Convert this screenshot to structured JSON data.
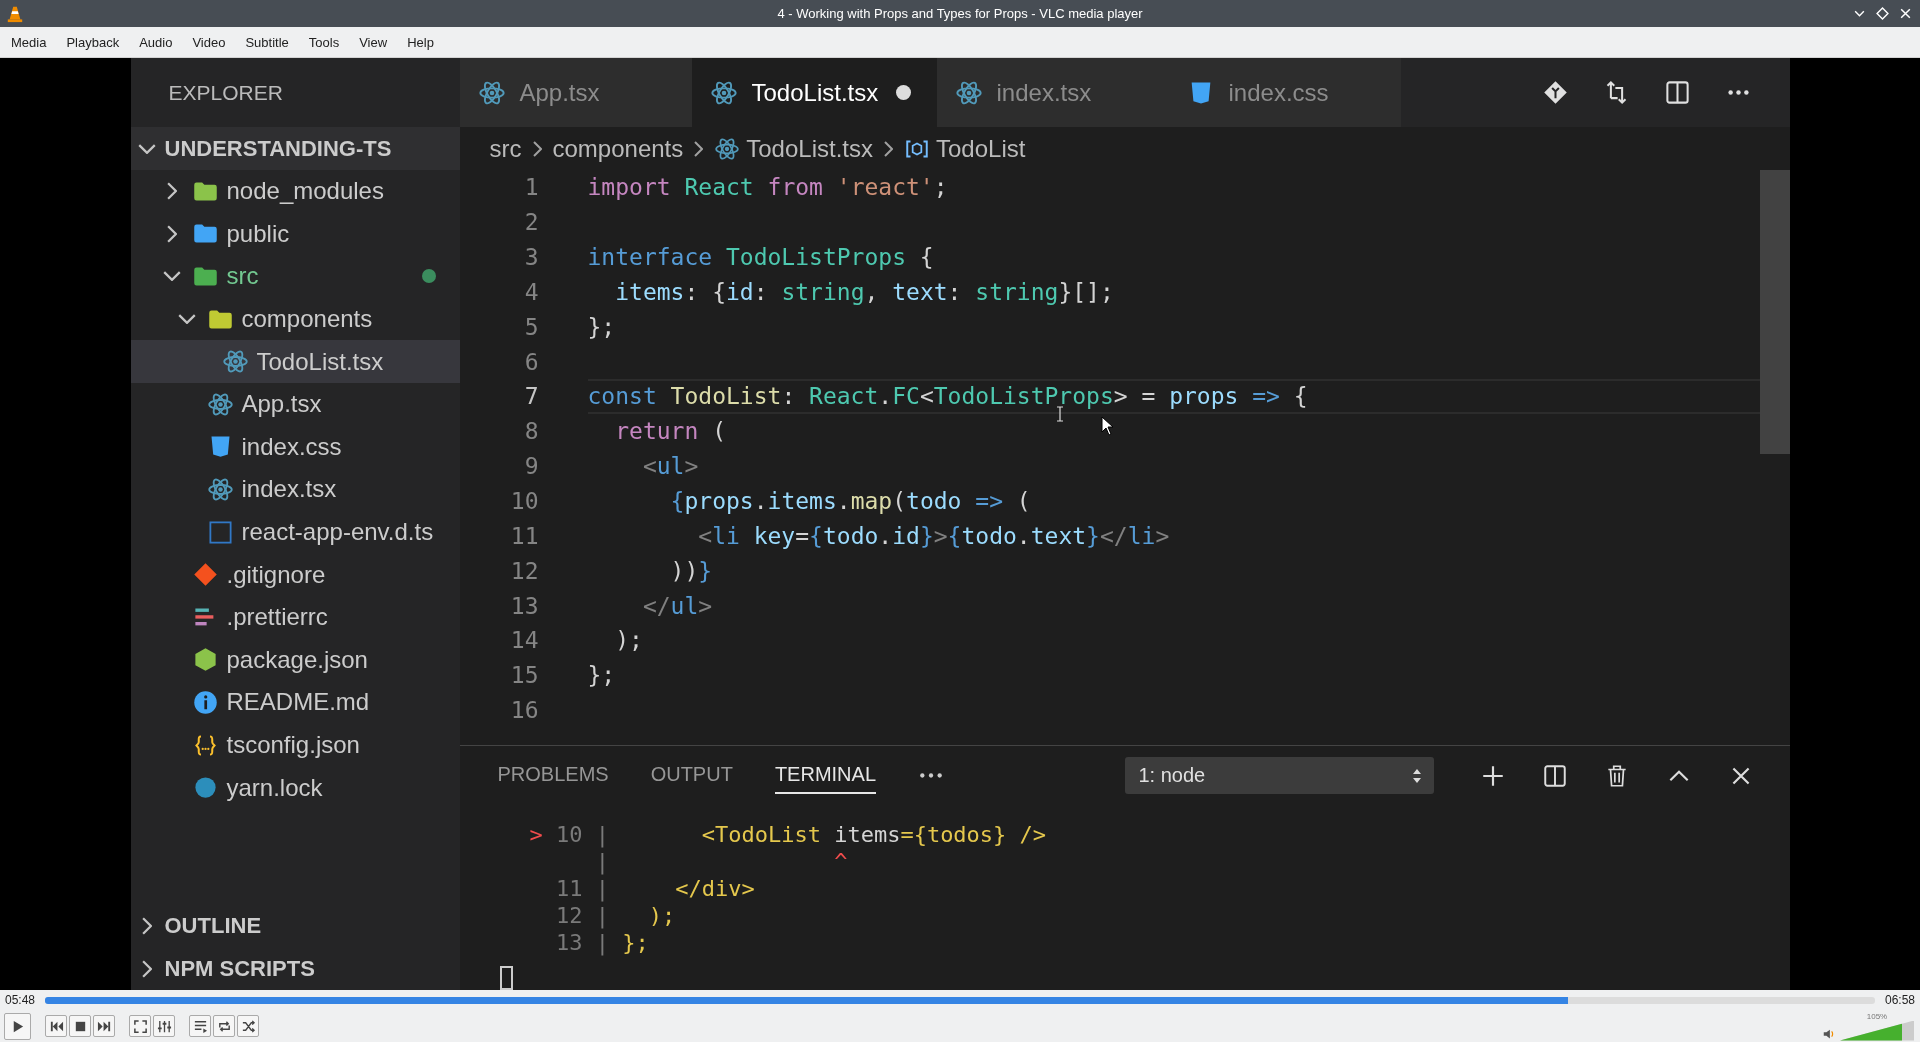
{
  "window": {
    "title": "4 - Working with Props and Types for Props - VLC media player"
  },
  "menu": [
    "Media",
    "Playback",
    "Audio",
    "Video",
    "Subtitle",
    "Tools",
    "View",
    "Help"
  ],
  "video": {
    "explorer": {
      "title": "EXPLORER",
      "project": {
        "name": "UNDERSTANDING-TS",
        "expanded": true,
        "children": [
          {
            "name": "node_modules",
            "kind": "modules",
            "expanded": false,
            "selected": false,
            "modified": false
          },
          {
            "name": "public",
            "kind": "public",
            "expanded": false,
            "selected": false,
            "modified": false
          },
          {
            "name": "src",
            "kind": "source",
            "expanded": true,
            "selected": false,
            "modified": true,
            "children": [
              {
                "name": "components",
                "kind": "components",
                "expanded": true,
                "selected": false,
                "modified": false,
                "children": [
                  {
                    "name": "TodoList.tsx",
                    "kind": "react",
                    "selected": true,
                    "modified": false
                  }
                ]
              },
              {
                "name": "App.tsx",
                "kind": "react",
                "selected": false,
                "modified": false
              },
              {
                "name": "index.css",
                "kind": "css",
                "selected": false,
                "modified": false
              },
              {
                "name": "index.tsx",
                "kind": "react",
                "selected": false,
                "modified": false
              },
              {
                "name": "react-app-env.d.ts",
                "kind": "typescript",
                "selected": false,
                "modified": false
              }
            ]
          },
          {
            "name": ".gitignore",
            "kind": "git",
            "selected": false,
            "modified": false
          },
          {
            "name": ".prettierrc",
            "kind": "prettier",
            "selected": false,
            "modified": false
          },
          {
            "name": "package.json",
            "kind": "node",
            "selected": false,
            "modified": false
          },
          {
            "name": "README.md",
            "kind": "readme",
            "selected": false,
            "modified": false
          },
          {
            "name": "tsconfig.json",
            "kind": "json",
            "selected": false,
            "modified": false
          },
          {
            "name": "yarn.lock",
            "kind": "yarn",
            "selected": false,
            "modified": false
          }
        ]
      },
      "sections": [
        {
          "name": "OUTLINE",
          "expanded": false
        },
        {
          "name": "NPM SCRIPTS",
          "expanded": false
        }
      ]
    },
    "editor": {
      "tabs": [
        {
          "label": "App.tsx",
          "kind": "react",
          "selected": false,
          "modified": false
        },
        {
          "label": "TodoList.tsx",
          "kind": "react",
          "selected": true,
          "modified": true
        },
        {
          "label": "index.tsx",
          "kind": "react",
          "selected": false,
          "modified": false
        },
        {
          "label": "index.css",
          "kind": "css",
          "selected": false,
          "modified": false
        }
      ],
      "breadcrumb": [
        {
          "label": "src",
          "kind": "folder"
        },
        {
          "label": "components",
          "kind": "folder"
        },
        {
          "label": "TodoList.tsx",
          "kind": "file"
        },
        {
          "label": "TodoList",
          "kind": "symbol"
        }
      ],
      "lines": [
        {
          "number": "1",
          "current": false,
          "tokens": [
            {
              "text": "import",
              "kind": "keyword"
            },
            {
              "text": " React",
              "kind": "type"
            },
            {
              "text": " from",
              "kind": "keyword"
            },
            {
              "text": " 'react'",
              "kind": "string"
            },
            {
              "text": ";",
              "kind": "plain"
            }
          ]
        },
        {
          "number": "2",
          "current": false
        },
        {
          "number": "3",
          "current": false,
          "tokens": [
            {
              "text": "interface",
              "kind": "storage"
            },
            {
              "text": " TodoListProps",
              "kind": "type"
            },
            {
              "text": " {",
              "kind": "plain"
            }
          ]
        },
        {
          "number": "4",
          "current": false,
          "tokens": [
            {
              "text": "  items",
              "kind": "variable"
            },
            {
              "text": ": {",
              "kind": "plain"
            },
            {
              "text": "id",
              "kind": "variable"
            },
            {
              "text": ": ",
              "kind": "plain"
            },
            {
              "text": "string",
              "kind": "type"
            },
            {
              "text": ", ",
              "kind": "plain"
            },
            {
              "text": "text",
              "kind": "variable"
            },
            {
              "text": ": ",
              "kind": "plain"
            },
            {
              "text": "string",
              "kind": "type"
            },
            {
              "text": "}[];",
              "kind": "plain"
            }
          ]
        },
        {
          "number": "5",
          "current": false,
          "tokens": [
            {
              "text": "};",
              "kind": "plain"
            }
          ]
        },
        {
          "number": "6",
          "current": false
        },
        {
          "number": "7",
          "current": true,
          "tokens": [
            {
              "text": "const",
              "kind": "storage"
            },
            {
              "text": " TodoList",
              "kind": "function"
            },
            {
              "text": ": ",
              "kind": "plain"
            },
            {
              "text": "React",
              "kind": "type"
            },
            {
              "text": ".",
              "kind": "plain"
            },
            {
              "text": "FC",
              "kind": "type"
            },
            {
              "text": "<",
              "kind": "plain"
            },
            {
              "text": "TodoListProps",
              "kind": "type"
            },
            {
              "text": "> = ",
              "kind": "plain"
            },
            {
              "text": "props",
              "kind": "variable"
            },
            {
              "text": " =>",
              "kind": "storage"
            },
            {
              "text": " {",
              "kind": "plain"
            }
          ]
        },
        {
          "number": "8",
          "current": false,
          "tokens": [
            {
              "text": "  return",
              "kind": "keyword"
            },
            {
              "text": " (",
              "kind": "plain"
            }
          ]
        },
        {
          "number": "9",
          "current": false,
          "tokens": [
            {
              "text": "    <",
              "kind": "punct"
            },
            {
              "text": "ul",
              "kind": "tag"
            },
            {
              "text": ">",
              "kind": "punct"
            }
          ]
        },
        {
          "number": "10",
          "current": false,
          "tokens": [
            {
              "text": "      {",
              "kind": "storage"
            },
            {
              "text": "props",
              "kind": "variable"
            },
            {
              "text": ".",
              "kind": "plain"
            },
            {
              "text": "items",
              "kind": "variable"
            },
            {
              "text": ".",
              "kind": "plain"
            },
            {
              "text": "map",
              "kind": "function"
            },
            {
              "text": "(",
              "kind": "plain"
            },
            {
              "text": "todo",
              "kind": "variable"
            },
            {
              "text": " =>",
              "kind": "storage"
            },
            {
              "text": " (",
              "kind": "plain"
            }
          ]
        },
        {
          "number": "11",
          "current": false,
          "tokens": [
            {
              "text": "        <",
              "kind": "punct"
            },
            {
              "text": "li",
              "kind": "tag"
            },
            {
              "text": " key",
              "kind": "variable"
            },
            {
              "text": "=",
              "kind": "plain"
            },
            {
              "text": "{",
              "kind": "storage"
            },
            {
              "text": "todo",
              "kind": "variable"
            },
            {
              "text": ".",
              "kind": "plain"
            },
            {
              "text": "id",
              "kind": "variable"
            },
            {
              "text": "}",
              "kind": "storage"
            },
            {
              "text": ">",
              "kind": "punct"
            },
            {
              "text": "{",
              "kind": "storage"
            },
            {
              "text": "todo",
              "kind": "variable"
            },
            {
              "text": ".",
              "kind": "plain"
            },
            {
              "text": "text",
              "kind": "variable"
            },
            {
              "text": "}",
              "kind": "storage"
            },
            {
              "text": "</",
              "kind": "punct"
            },
            {
              "text": "li",
              "kind": "tag"
            },
            {
              "text": ">",
              "kind": "punct"
            }
          ]
        },
        {
          "number": "12",
          "current": false,
          "tokens": [
            {
              "text": "      ))",
              "kind": "plain"
            },
            {
              "text": "}",
              "kind": "storage"
            }
          ]
        },
        {
          "number": "13",
          "current": false,
          "tokens": [
            {
              "text": "    </",
              "kind": "punct"
            },
            {
              "text": "ul",
              "kind": "tag"
            },
            {
              "text": ">",
              "kind": "punct"
            }
          ]
        },
        {
          "number": "14",
          "current": false,
          "tokens": [
            {
              "text": "  );",
              "kind": "plain"
            }
          ]
        },
        {
          "number": "15",
          "current": false,
          "tokens": [
            {
              "text": "};",
              "kind": "plain"
            }
          ]
        },
        {
          "number": "16",
          "current": false
        }
      ]
    },
    "panel": {
      "tabs": [
        {
          "label": "PROBLEMS",
          "selected": false
        },
        {
          "label": "OUTPUT",
          "selected": false
        },
        {
          "label": "TERMINAL",
          "selected": true
        }
      ],
      "terminal_select": "1: node",
      "lines": [
        [
          {
            "text": "> ",
            "kind": "marker"
          },
          {
            "text": "10 | ",
            "kind": "gutter"
          },
          {
            "text": "      <TodoList ",
            "kind": "code"
          },
          {
            "text": "items",
            "kind": "plain"
          },
          {
            "text": "={todos} />",
            "kind": "code"
          }
        ],
        [
          {
            "text": "     | ",
            "kind": "gutter"
          },
          {
            "text": "                ^",
            "kind": "marker"
          }
        ],
        [
          {
            "text": "  11 | ",
            "kind": "gutter"
          },
          {
            "text": "    </div>",
            "kind": "code"
          }
        ],
        [
          {
            "text": "  12 | ",
            "kind": "gutter"
          },
          {
            "text": "  );",
            "kind": "code"
          }
        ],
        [
          {
            "text": "  13 | ",
            "kind": "gutter"
          },
          {
            "text": "};",
            "kind": "code"
          }
        ]
      ]
    }
  },
  "player": {
    "elapsed": "05:48",
    "total": "06:58",
    "seek": {
      "level": 0.832
    },
    "volume": {
      "level": 0.84,
      "reading": "105%"
    }
  }
}
